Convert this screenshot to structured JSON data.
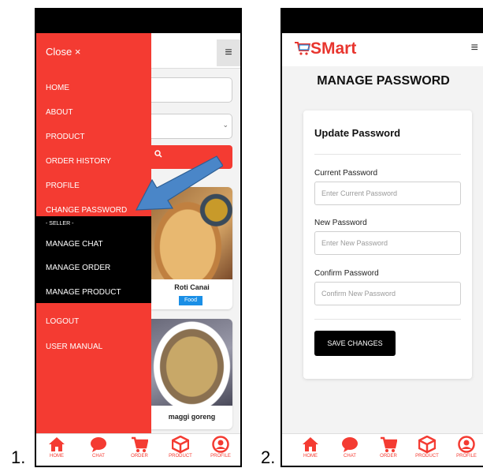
{
  "figure": {
    "label_1": "1.",
    "label_2": "2."
  },
  "screen1": {
    "drawer": {
      "close_label": "Close ×",
      "items": [
        {
          "label": "HOME"
        },
        {
          "label": "ABOUT"
        },
        {
          "label": "PRODUCT"
        },
        {
          "label": "ORDER HISTORY"
        },
        {
          "label": "PROFILE"
        },
        {
          "label": "CHANGE PASSWORD"
        }
      ],
      "seller_label": "- SELLER -",
      "seller_items": [
        {
          "label": "MANAGE CHAT"
        },
        {
          "label": "MANAGE ORDER"
        },
        {
          "label": "MANAGE PRODUCT"
        }
      ],
      "bottom_items": [
        {
          "label": "LOGOUT"
        },
        {
          "label": "USER MANUAL"
        }
      ]
    },
    "products": [
      {
        "name": "Roti Canai",
        "tag": "Food"
      },
      {
        "name": "maggi goreng"
      }
    ],
    "colors": {
      "brand": "#f43b32",
      "seller_bg": "#000000",
      "tag": "#1a8fe6",
      "arrow": "#4a86c8"
    }
  },
  "screen2": {
    "brand": "SMart",
    "title": "MANAGE PASSWORD",
    "form": {
      "title": "Update Password",
      "fields": [
        {
          "label": "Current Password",
          "placeholder": "Enter Current Password"
        },
        {
          "label": "New Password",
          "placeholder": "Enter New Password"
        },
        {
          "label": "Confirm Password",
          "placeholder": "Confirm New Password"
        }
      ],
      "submit_label": "SAVE CHANGES"
    }
  },
  "bottom_nav": [
    {
      "label": "HOME",
      "icon": "home-icon"
    },
    {
      "label": "CHAT",
      "icon": "chat-icon"
    },
    {
      "label": "ORDER",
      "icon": "cart-icon"
    },
    {
      "label": "PRODUCT",
      "icon": "box-icon"
    },
    {
      "label": "PROFILE",
      "icon": "user-icon"
    }
  ]
}
